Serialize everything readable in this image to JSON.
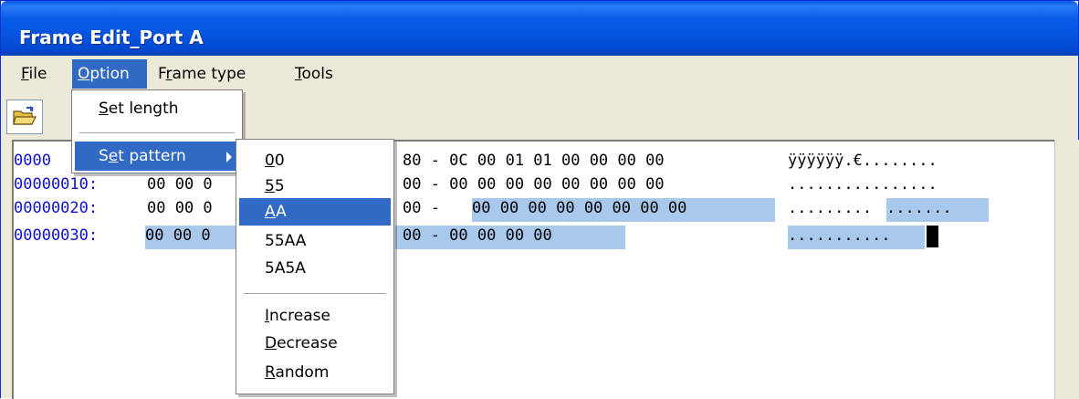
{
  "window": {
    "title": "Frame Edit_Port A"
  },
  "menubar": {
    "items": [
      {
        "label": "File",
        "accel": "F",
        "rest": "ile"
      },
      {
        "label": "Option",
        "accel": "O",
        "rest": "ption"
      },
      {
        "label": "Frame type",
        "pre": "F",
        "accel": "r",
        "rest": "ame type"
      },
      {
        "label": "Tools",
        "accel": "T",
        "rest": "ools"
      }
    ]
  },
  "toolbar": {
    "open_icon": "open-folder-icon"
  },
  "hexview": {
    "rows": [
      {
        "addr": "0000",
        "hex_visible": "80 - 0C 00 01 01 00 00 00 00",
        "ascii": "ÿÿÿÿÿÿ.€........"
      },
      {
        "addr": "00000010:",
        "hex_left": "00 00 0",
        "hex_visible": "00 - 00 00 00 00 00 00 00 00",
        "ascii": "................"
      },
      {
        "addr": "00000020:",
        "hex_left": "00 00 0",
        "hex_visible": "00 - ",
        "hex_selected": "00 00 00 00 00 00 00 00",
        "ascii": ".........",
        "ascii_selected": "......."
      },
      {
        "addr": "00000030:",
        "hex_left": "00 00 0",
        "hex_visible": "00 - 00 00 00 00",
        "ascii_selected": "..........."
      }
    ]
  },
  "option_menu": {
    "items": [
      {
        "accel": "S",
        "rest": "et length"
      },
      {
        "pre": "S",
        "accel": "e",
        "rest": "t pattern"
      }
    ]
  },
  "pattern_submenu": {
    "items": [
      {
        "accel": "0",
        "rest": "0"
      },
      {
        "accel": "5",
        "rest": "5"
      },
      {
        "accel": "A",
        "rest": "A"
      },
      {
        "label": "55AA"
      },
      {
        "label": "5A5A"
      },
      {
        "accel": "I",
        "rest": "ncrease"
      },
      {
        "accel": "D",
        "rest": "ecrease"
      },
      {
        "accel": "R",
        "rest": "andom"
      }
    ]
  }
}
